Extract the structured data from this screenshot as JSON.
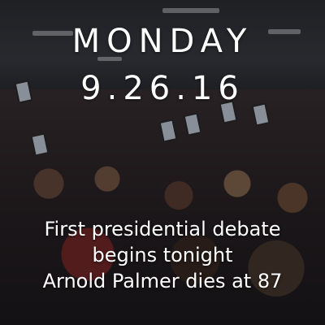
{
  "header": {
    "day": "MONDAY",
    "date": "9.26.16"
  },
  "headlines": [
    "First presidential debate",
    "begins tonight",
    "Arnold Palmer dies at 87"
  ]
}
